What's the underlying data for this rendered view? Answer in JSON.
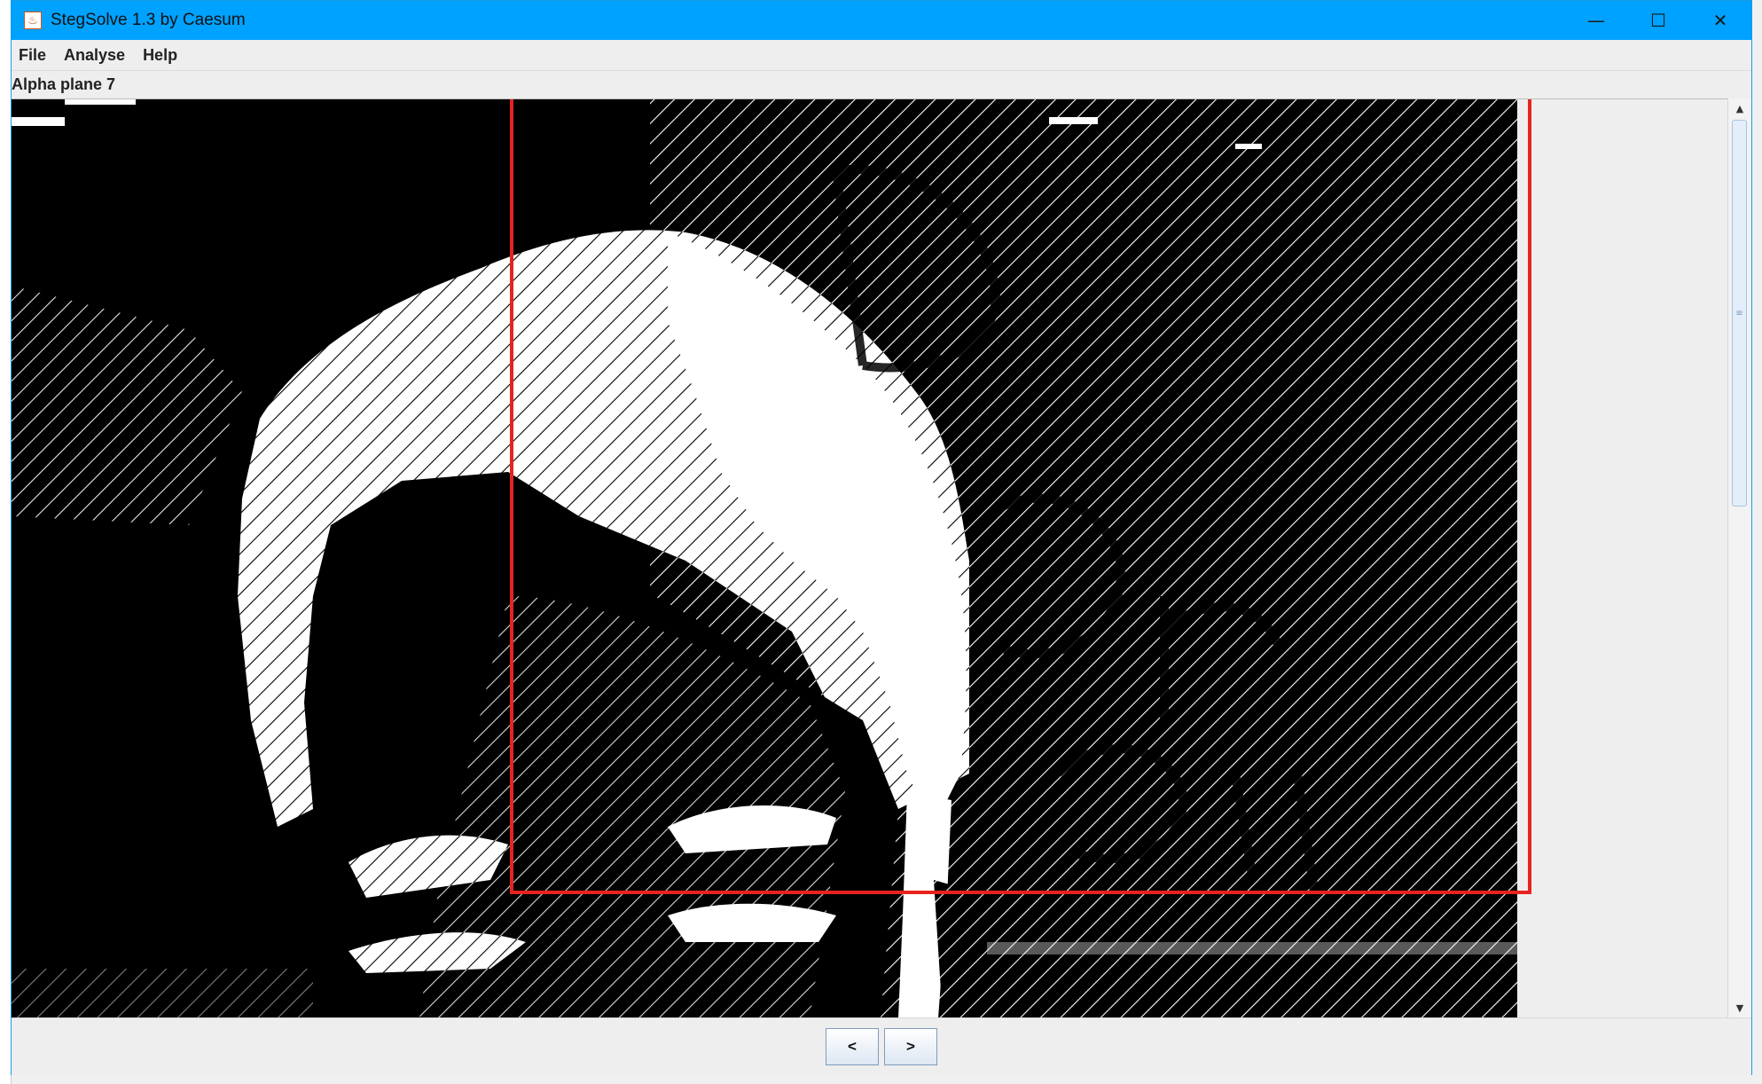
{
  "window": {
    "title": "StegSolve 1.3 by Caesum",
    "app_icon_glyph": "♨",
    "minimize_glyph": "—",
    "maximize_glyph": "☐",
    "close_glyph": "✕"
  },
  "menu": {
    "items": [
      "File",
      "Analyse",
      "Help"
    ]
  },
  "viewer": {
    "plane_label": "Alpha plane 7"
  },
  "scrollbar": {
    "up_glyph": "▲",
    "down_glyph": "▼",
    "thumb_grip": "≡",
    "position": 0.0
  },
  "navigation": {
    "prev_label": "<",
    "next_label": ">"
  },
  "colors": {
    "titlebar": "#00a2ff",
    "highlight_box": "#e8231f"
  }
}
